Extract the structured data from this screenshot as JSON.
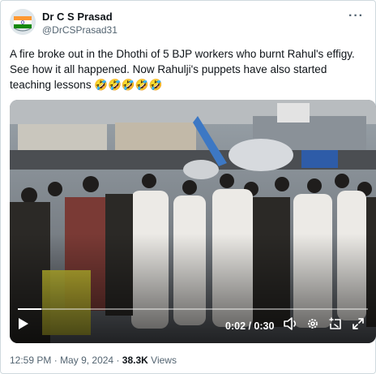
{
  "author": {
    "name": "Dr C S Prasad",
    "handle": "@DrCSPrasad31"
  },
  "tweet": {
    "text": "A fire broke out in the Dhothi of 5 BJP workers who burnt Rahul's effigy. See how it all happened. Now Rahulji's puppets have also started teaching lessons 🤣🤣🤣🤣🤣"
  },
  "video": {
    "time": "0:02 / 0:30",
    "progress": 0.067,
    "accent_color": "#ffffff"
  },
  "meta": {
    "time": "12:59 PM",
    "date": "May 9, 2024",
    "separator": "·",
    "views_count": "38.3K",
    "views_label": "Views"
  },
  "icons": {
    "more": "more-options-icon",
    "play": "play-icon",
    "volume": "volume-icon",
    "settings": "settings-gear-icon",
    "pip": "picture-in-picture-icon",
    "fullscreen": "fullscreen-icon"
  }
}
